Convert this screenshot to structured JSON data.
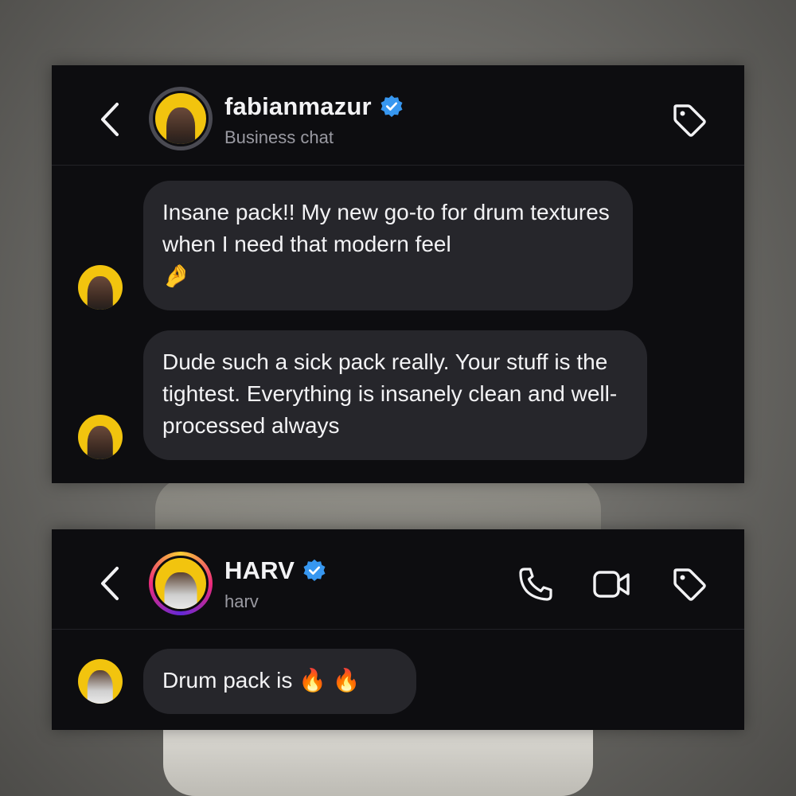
{
  "chat_1": {
    "title": "fabianmazur",
    "subtitle": "Business chat",
    "header_icons": [
      "back-chevron-icon",
      "verified-badge-icon",
      "tag-icon"
    ],
    "messages": [
      {
        "text": "Insane pack!! My new go-to for drum textures when I need that modern feel",
        "emoji": "🤌"
      },
      {
        "text": "Dude such a sick pack really. Your stuff is the tightest. Everything is insanely clean and well-processed always"
      }
    ]
  },
  "chat_2": {
    "title": "HARV",
    "subtitle": "harv",
    "header_icons": [
      "back-chevron-icon",
      "verified-badge-icon",
      "phone-icon",
      "video-camera-icon",
      "tag-icon"
    ],
    "messages": [
      {
        "text": "Drum pack is 🔥 🔥"
      }
    ]
  },
  "colors": {
    "panel_bg": "#0d0d10",
    "bubble_bg": "#26262b",
    "verified_blue": "#3797f0",
    "avatar_yellow": "#f2c40e",
    "text_primary": "#f2f2f4",
    "text_secondary": "#9a9aa2"
  }
}
